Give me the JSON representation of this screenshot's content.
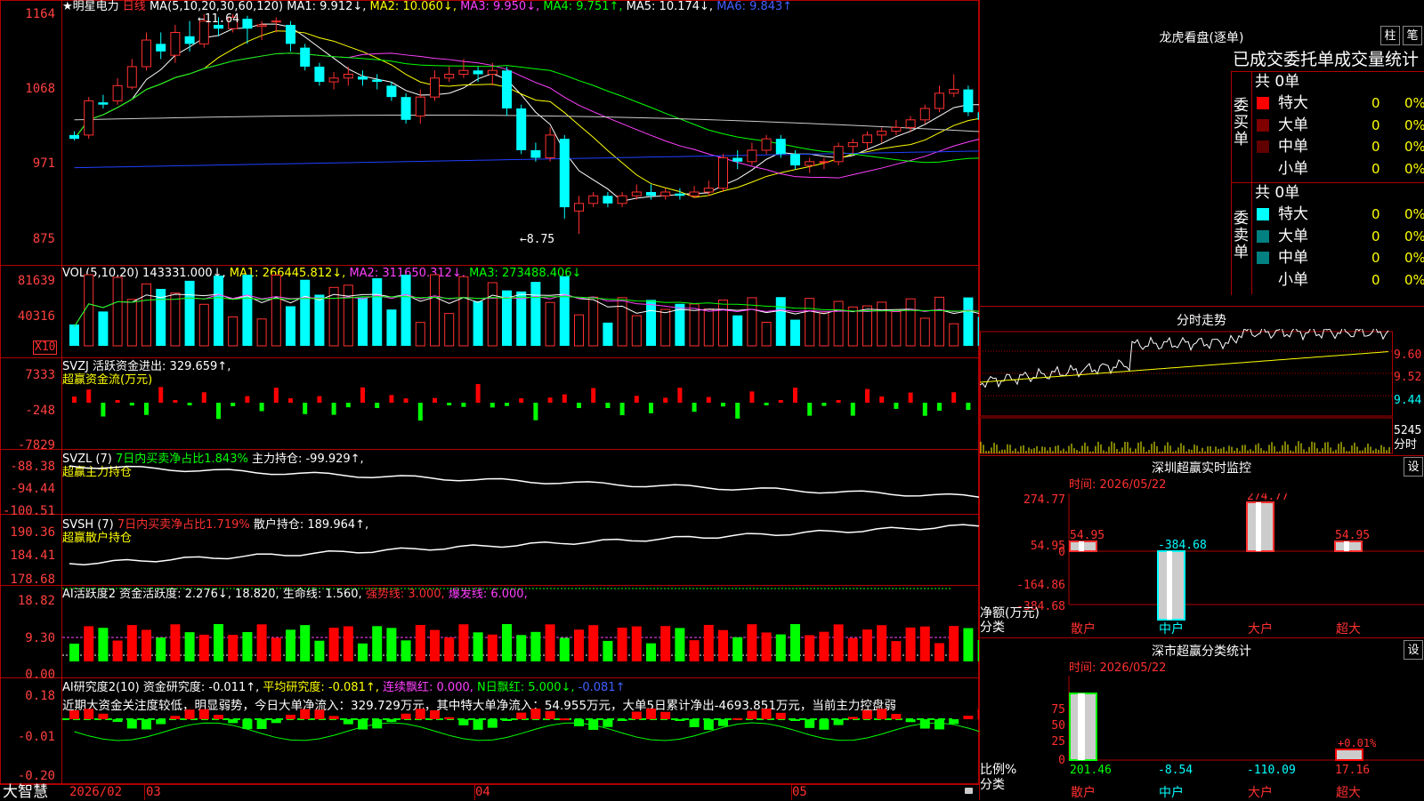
{
  "colors": {
    "up": "#ff3030",
    "down": "#00ffff",
    "red": "#ff0000",
    "green": "#00ff00",
    "yellow": "#ffff00",
    "magenta": "#ff40ff",
    "white": "#ffffff",
    "blue": "#0000ff",
    "grid": "#b00000"
  },
  "main": {
    "title_prefix": "★明星电力",
    "period": "日线",
    "ma_params": "MA(5,10,20,30,60,120)",
    "ma1": "MA1: 9.912↓,",
    "ma2": "MA2: 10.060↓,",
    "ma3": "MA3: 9.950↓,",
    "ma4": "MA4: 9.751↑,",
    "ma5": "MA5: 10.174↓,",
    "ma6": "MA6: 9.843↑",
    "y_ticks": [
      "1164",
      "1068",
      "971",
      "875"
    ],
    "high_label": "←11.64",
    "low_label": "←8.75"
  },
  "vol": {
    "params": "VOL(5,10,20)",
    "value": "143331.000↓,",
    "ma1": "MA1: 266445.812↓,",
    "ma2": "MA2: 311650.312↓,",
    "ma3": "MA3: 273488.406↓",
    "y_ticks": [
      "81639",
      "40316"
    ],
    "unit": "X10"
  },
  "svzj": {
    "name": "SVZJ",
    "label": "活跃资金进出: 329.659↑,",
    "sub": "超赢资金流(万元)",
    "y_ticks": [
      "7333",
      "-248",
      "-7829"
    ]
  },
  "svzl": {
    "name": "SVZL (7)",
    "ratio": "7日内买卖净占比1.843%",
    "hold": "主力持仓: -99.929↑,",
    "sub": "超赢主力持仓",
    "y_ticks": [
      "-88.38",
      "-94.44",
      "-100.51"
    ]
  },
  "svsh": {
    "name": "SVSH (7)",
    "ratio": "7日内买卖净占比1.719%",
    "hold": "散户持仓: 189.964↑,",
    "sub": "超赢散户持仓",
    "y_ticks": [
      "190.36",
      "184.41",
      "178.68"
    ]
  },
  "ai_act": {
    "name": "AI活跃度2",
    "v1": "资金活跃度: 2.276↓,",
    "v2": "18.820,",
    "v3": "生命线: 1.560,",
    "v4": "强势线: 3.000,",
    "v5": "爆发线: 6.000,",
    "y_ticks": [
      "18.82",
      "9.30",
      "0.00"
    ]
  },
  "ai_res": {
    "name": "AI研究度2(10)",
    "v1": "资金研究度: -0.011↑,",
    "v2": "平均研究度: -0.081↑,",
    "v3": "连续飘红: 0.000,",
    "v4": "N日飘红: 5.000↓,",
    "v5": "-0.081↑",
    "comment": "近期大资金关注度较低，明显弱势，今日大单净流入：329.729万元，其中特大单净流入：54.955万元，大单5日累计净出-4693.851万元，当前主力控盘弱",
    "y_ticks": [
      "0.18",
      "-0.01",
      "-0.20"
    ]
  },
  "bottom": {
    "brand": "大智慧",
    "dates": [
      "2026/02",
      "03",
      "04",
      "05"
    ]
  },
  "right": {
    "lh_title": "龙虎看盘(逐单)",
    "btn1": "柱",
    "btn2": "笔",
    "lh_header": "已成交委托单成交量统计",
    "buy_label": "委买单",
    "buy_total": "共 0单",
    "sell_label": "委卖单",
    "sell_total": "共 0单",
    "rows_buy": [
      {
        "name": "特大",
        "count": "0",
        "pct": "0%"
      },
      {
        "name": "大单",
        "count": "0",
        "pct": "0%"
      },
      {
        "name": "中单",
        "count": "0",
        "pct": "0%"
      },
      {
        "name": "小单",
        "count": "0",
        "pct": "0%"
      }
    ],
    "rows_sell": [
      {
        "name": "特大",
        "count": "0",
        "pct": "0%"
      },
      {
        "name": "大单",
        "count": "0",
        "pct": "0%"
      },
      {
        "name": "中单",
        "count": "0",
        "pct": "0%"
      },
      {
        "name": "小单",
        "count": "0",
        "pct": "0%"
      }
    ],
    "ts_title": "分时走势",
    "ts_prices": [
      "9.60",
      "9.52",
      "9.44"
    ],
    "ts_vol": "5245",
    "ts_unit": "分时",
    "sz_title": "深圳超赢实时监控",
    "sz_btn": "设",
    "sz_time": "时间: 2026/05/22",
    "sz_ticks": [
      "274.77",
      "54.95",
      "0",
      "-164.86",
      "-384.68"
    ],
    "sz_ylabel": "净额(万元)",
    "sz_xlabel": "分类",
    "sz_cats": [
      "散户",
      "中户",
      "大户",
      "超大"
    ],
    "sz_values": [
      "54.95",
      "-384.68",
      "274.77",
      "54.95"
    ],
    "sm_title": "深市超赢分类统计",
    "sm_btn": "设",
    "sm_time": "时间: 2026/05/22",
    "sm_ticks": [
      "75",
      "50",
      "25",
      "0"
    ],
    "sm_ylabel": "比例%",
    "sm_xlabel": "分类",
    "sm_cats": [
      "散户",
      "中户",
      "大户",
      "超大"
    ],
    "sm_values": [
      "201.46",
      "-8.54",
      "-110.09",
      "17.16"
    ],
    "sm_pct": "+0.01%"
  },
  "chart_data": {
    "type": "candlestick",
    "ylim": [
      8.75,
      11.64
    ],
    "candles": [
      [
        10.05,
        10.0,
        10.1,
        9.98
      ],
      [
        10.05,
        10.5,
        10.55,
        10.0
      ],
      [
        10.48,
        10.45,
        10.58,
        10.4
      ],
      [
        10.5,
        10.7,
        10.8,
        10.45
      ],
      [
        10.68,
        10.95,
        11.05,
        10.65
      ],
      [
        10.95,
        11.3,
        11.4,
        10.9
      ],
      [
        11.25,
        11.15,
        11.4,
        11.05
      ],
      [
        11.1,
        11.4,
        11.5,
        11.0
      ],
      [
        11.35,
        11.25,
        11.55,
        11.15
      ],
      [
        11.25,
        11.55,
        11.64,
        11.2
      ],
      [
        11.5,
        11.45,
        11.6,
        11.35
      ],
      [
        11.45,
        11.6,
        11.64,
        11.4
      ],
      [
        11.58,
        11.45,
        11.62,
        11.25
      ],
      [
        11.48,
        11.5,
        11.55,
        11.3
      ],
      [
        11.55,
        11.55,
        11.6,
        11.4
      ],
      [
        11.5,
        11.25,
        11.55,
        11.15
      ],
      [
        11.2,
        10.95,
        11.25,
        10.9
      ],
      [
        10.95,
        10.75,
        11.0,
        10.7
      ],
      [
        10.75,
        10.8,
        10.88,
        10.65
      ],
      [
        10.8,
        10.85,
        10.95,
        10.7
      ],
      [
        10.82,
        10.78,
        10.9,
        10.7
      ],
      [
        10.78,
        10.75,
        10.85,
        10.65
      ],
      [
        10.7,
        10.55,
        10.75,
        10.5
      ],
      [
        10.55,
        10.25,
        10.6,
        10.2
      ],
      [
        10.3,
        10.55,
        10.65,
        10.2
      ],
      [
        10.55,
        10.8,
        10.9,
        10.5
      ],
      [
        10.8,
        10.85,
        10.95,
        10.75
      ],
      [
        10.85,
        10.9,
        11.05,
        10.8
      ],
      [
        10.9,
        10.85,
        10.95,
        10.75
      ],
      [
        10.85,
        10.9,
        11.0,
        10.7
      ],
      [
        10.9,
        10.4,
        10.95,
        10.3
      ],
      [
        10.4,
        9.85,
        10.45,
        9.8
      ],
      [
        9.85,
        9.75,
        9.95,
        9.7
      ],
      [
        9.75,
        10.05,
        10.15,
        9.7
      ],
      [
        10.0,
        9.1,
        10.05,
        8.95
      ],
      [
        9.05,
        9.15,
        9.25,
        8.75
      ],
      [
        9.15,
        9.25,
        9.3,
        9.1
      ],
      [
        9.25,
        9.15,
        9.3,
        9.1
      ],
      [
        9.15,
        9.25,
        9.3,
        9.1
      ],
      [
        9.25,
        9.3,
        9.4,
        9.2
      ],
      [
        9.3,
        9.25,
        9.4,
        9.2
      ],
      [
        9.25,
        9.3,
        9.35,
        9.2
      ],
      [
        9.28,
        9.25,
        9.35,
        9.2
      ],
      [
        9.25,
        9.3,
        9.38,
        9.22
      ],
      [
        9.3,
        9.35,
        9.45,
        9.25
      ],
      [
        9.35,
        9.75,
        9.8,
        9.3
      ],
      [
        9.75,
        9.7,
        9.85,
        9.6
      ],
      [
        9.7,
        9.85,
        9.95,
        9.65
      ],
      [
        9.85,
        10.0,
        10.05,
        9.8
      ],
      [
        10.0,
        9.8,
        10.05,
        9.75
      ],
      [
        9.8,
        9.65,
        9.85,
        9.6
      ],
      [
        9.65,
        9.7,
        9.75,
        9.55
      ],
      [
        9.7,
        9.7,
        9.75,
        9.6
      ],
      [
        9.7,
        9.9,
        9.95,
        9.65
      ],
      [
        9.9,
        9.95,
        10.0,
        9.8
      ],
      [
        9.95,
        10.05,
        10.1,
        9.85
      ],
      [
        10.05,
        10.1,
        10.15,
        9.95
      ],
      [
        10.1,
        10.15,
        10.25,
        10.05
      ],
      [
        10.15,
        10.25,
        10.3,
        10.1
      ],
      [
        10.25,
        10.4,
        10.45,
        10.2
      ],
      [
        10.4,
        10.6,
        10.7,
        10.35
      ],
      [
        10.6,
        10.65,
        10.85,
        10.55
      ],
      [
        10.65,
        10.35,
        10.7,
        10.3
      ],
      [
        10.35,
        10.25,
        10.4,
        10.1
      ],
      [
        10.25,
        10.3,
        10.35,
        10.15
      ],
      [
        10.3,
        10.55,
        10.62,
        10.25
      ],
      [
        10.55,
        10.15,
        10.6,
        10.05
      ],
      [
        10.15,
        9.8,
        10.2,
        9.75
      ],
      [
        9.8,
        9.9,
        10.0,
        9.7
      ]
    ]
  }
}
